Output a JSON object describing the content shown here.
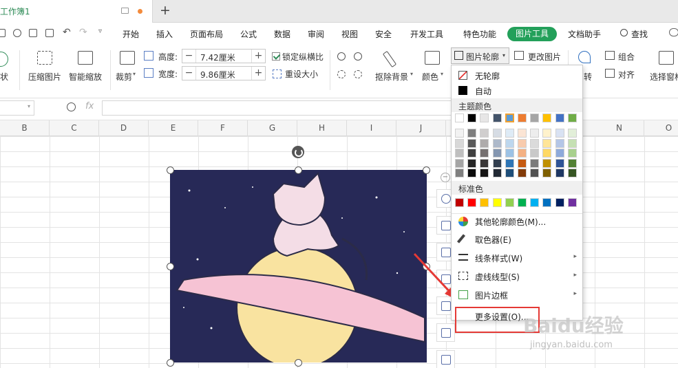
{
  "tab": {
    "title": "工作簿1"
  },
  "menu": [
    "开始",
    "插入",
    "页面布局",
    "公式",
    "数据",
    "审阅",
    "视图",
    "安全",
    "开发工具",
    "特色功能",
    "图片工具",
    "文档助手",
    "查找"
  ],
  "ribbon": {
    "shape_suffix": "状",
    "compress": "压缩图片",
    "smart_zoom": "智能缩放",
    "crop": "裁剪",
    "height_label": "高度:",
    "height_value": "7.42厘米",
    "width_label": "宽度:",
    "width_value": "9.86厘米",
    "lock_ratio": "锁定纵横比",
    "reset_size": "重设大小",
    "remove_bg": "抠除背景",
    "color": "颜色",
    "outline": "图片轮廓",
    "change_picture": "更改图片",
    "rotate_suffix": "转",
    "group": "组合",
    "align": "对齐",
    "selection_pane": "选择窗格"
  },
  "formula": {
    "fx": "fx"
  },
  "columns": [
    "B",
    "C",
    "D",
    "E",
    "F",
    "G",
    "H",
    "I",
    "J",
    "N",
    "O"
  ],
  "dropdown": {
    "no_outline": "无轮廓",
    "auto": "自动",
    "theme_colors": "主题颜色",
    "standard_colors": "标准色",
    "more_colors": "其他轮廓颜色(M)...",
    "picker": "取色器(E)",
    "line_style": "线条样式(W)",
    "dash_style": "虚线线型(S)",
    "picture_border": "图片边框",
    "more_settings": "更多设置(O)..."
  },
  "theme_top": [
    "#ffffff",
    "#000000",
    "#e7e6e6",
    "#44546a",
    "#5b9bd5",
    "#ed7d31",
    "#a5a5a5",
    "#ffc000",
    "#4472c4",
    "#70ad47"
  ],
  "theme_shades": [
    [
      "#f2f2f2",
      "#7f7f7f",
      "#d0cece",
      "#d6dce4",
      "#deebf6",
      "#fbe5d5",
      "#ededed",
      "#fff2cc",
      "#d9e2f3",
      "#e2efd9"
    ],
    [
      "#d8d8d8",
      "#595959",
      "#aeabab",
      "#adb9ca",
      "#bdd7ee",
      "#f8cbad",
      "#dbdbdb",
      "#ffe598",
      "#b4c6e7",
      "#c5e0b3"
    ],
    [
      "#bfbfbf",
      "#3f3f3f",
      "#757070",
      "#8496b0",
      "#9cc2e5",
      "#f4b183",
      "#c9c9c9",
      "#ffd965",
      "#8eaadb",
      "#a8d08d"
    ],
    [
      "#a5a5a5",
      "#262626",
      "#3a3838",
      "#323f4f",
      "#2e75b5",
      "#c55a11",
      "#7b7b7b",
      "#bf9000",
      "#2f5496",
      "#538135"
    ],
    [
      "#7f7f7f",
      "#0c0c0c",
      "#171616",
      "#222a35",
      "#1e4e79",
      "#833c0b",
      "#525252",
      "#7f6000",
      "#1f3864",
      "#375623"
    ]
  ],
  "standard": [
    "#c00000",
    "#ff0000",
    "#ffc000",
    "#ffff00",
    "#92d050",
    "#00b050",
    "#00b0f0",
    "#0070c0",
    "#002060",
    "#7030a0"
  ],
  "watermark": {
    "brand": "Baidu经验",
    "url": "jingyan.baidu.com"
  }
}
